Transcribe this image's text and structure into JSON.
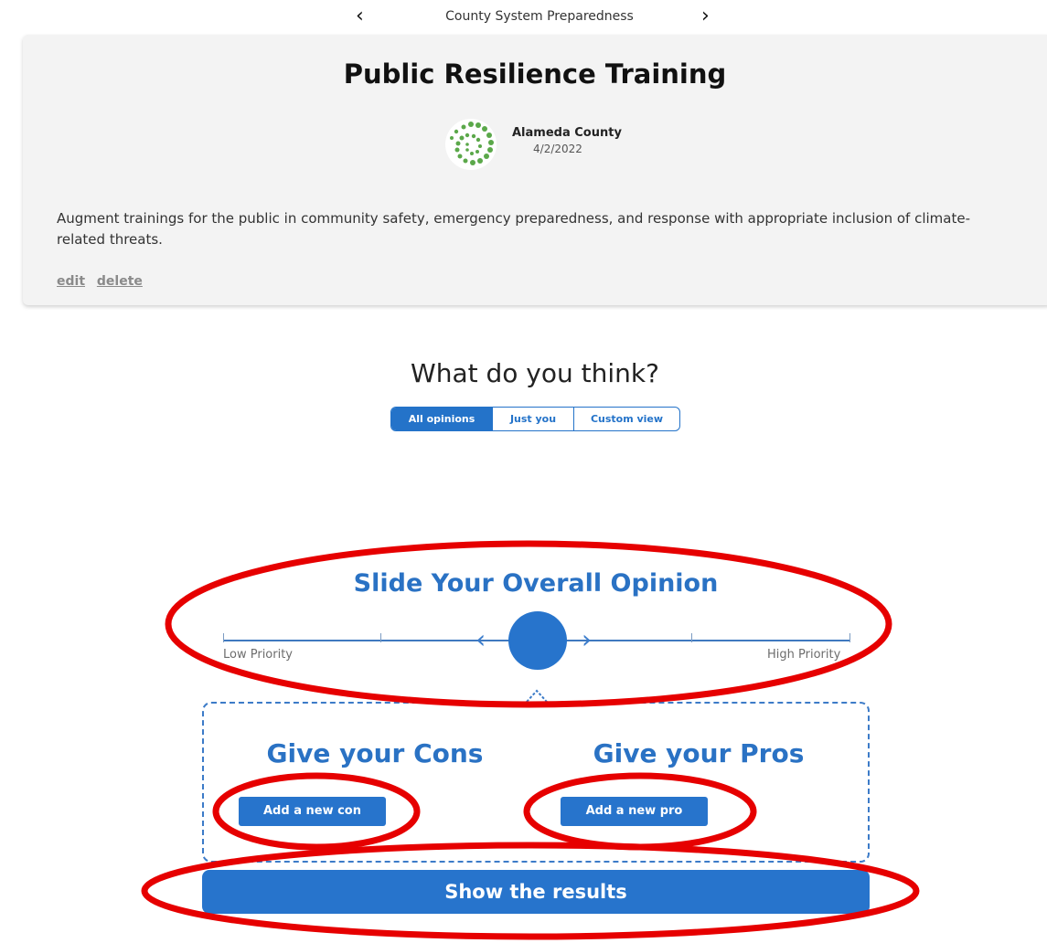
{
  "nav": {
    "title": "County System Preparedness",
    "prev_icon": "chevron-left-icon",
    "next_icon": "chevron-right-icon"
  },
  "post": {
    "title": "Public Resilience Training",
    "author": {
      "name": "Alameda County",
      "date": "4/2/2022",
      "avatar_icon": "green-spiral-logo"
    },
    "description": "Augment trainings for the public in community safety, emergency preparedness, and response with appropriate inclusion of climate-related threats.",
    "actions": {
      "edit": "edit",
      "delete": "delete"
    }
  },
  "opinion": {
    "heading": "What do you think?",
    "views": [
      {
        "label": "All opinions",
        "active": true
      },
      {
        "label": "Just you",
        "active": false
      },
      {
        "label": "Custom view",
        "active": false
      }
    ]
  },
  "slider": {
    "title": "Slide Your Overall Opinion",
    "low_label": "Low Priority",
    "high_label": "High Priority",
    "value": 0.5
  },
  "cons": {
    "heading": "Give your Cons",
    "button": "Add a new con"
  },
  "pros": {
    "heading": "Give your Pros",
    "button": "Add a new pro"
  },
  "results_button": "Show the results",
  "colors": {
    "accent": "#2774cc",
    "annotation": "#e60000",
    "card_bg": "#f3f3f3"
  }
}
